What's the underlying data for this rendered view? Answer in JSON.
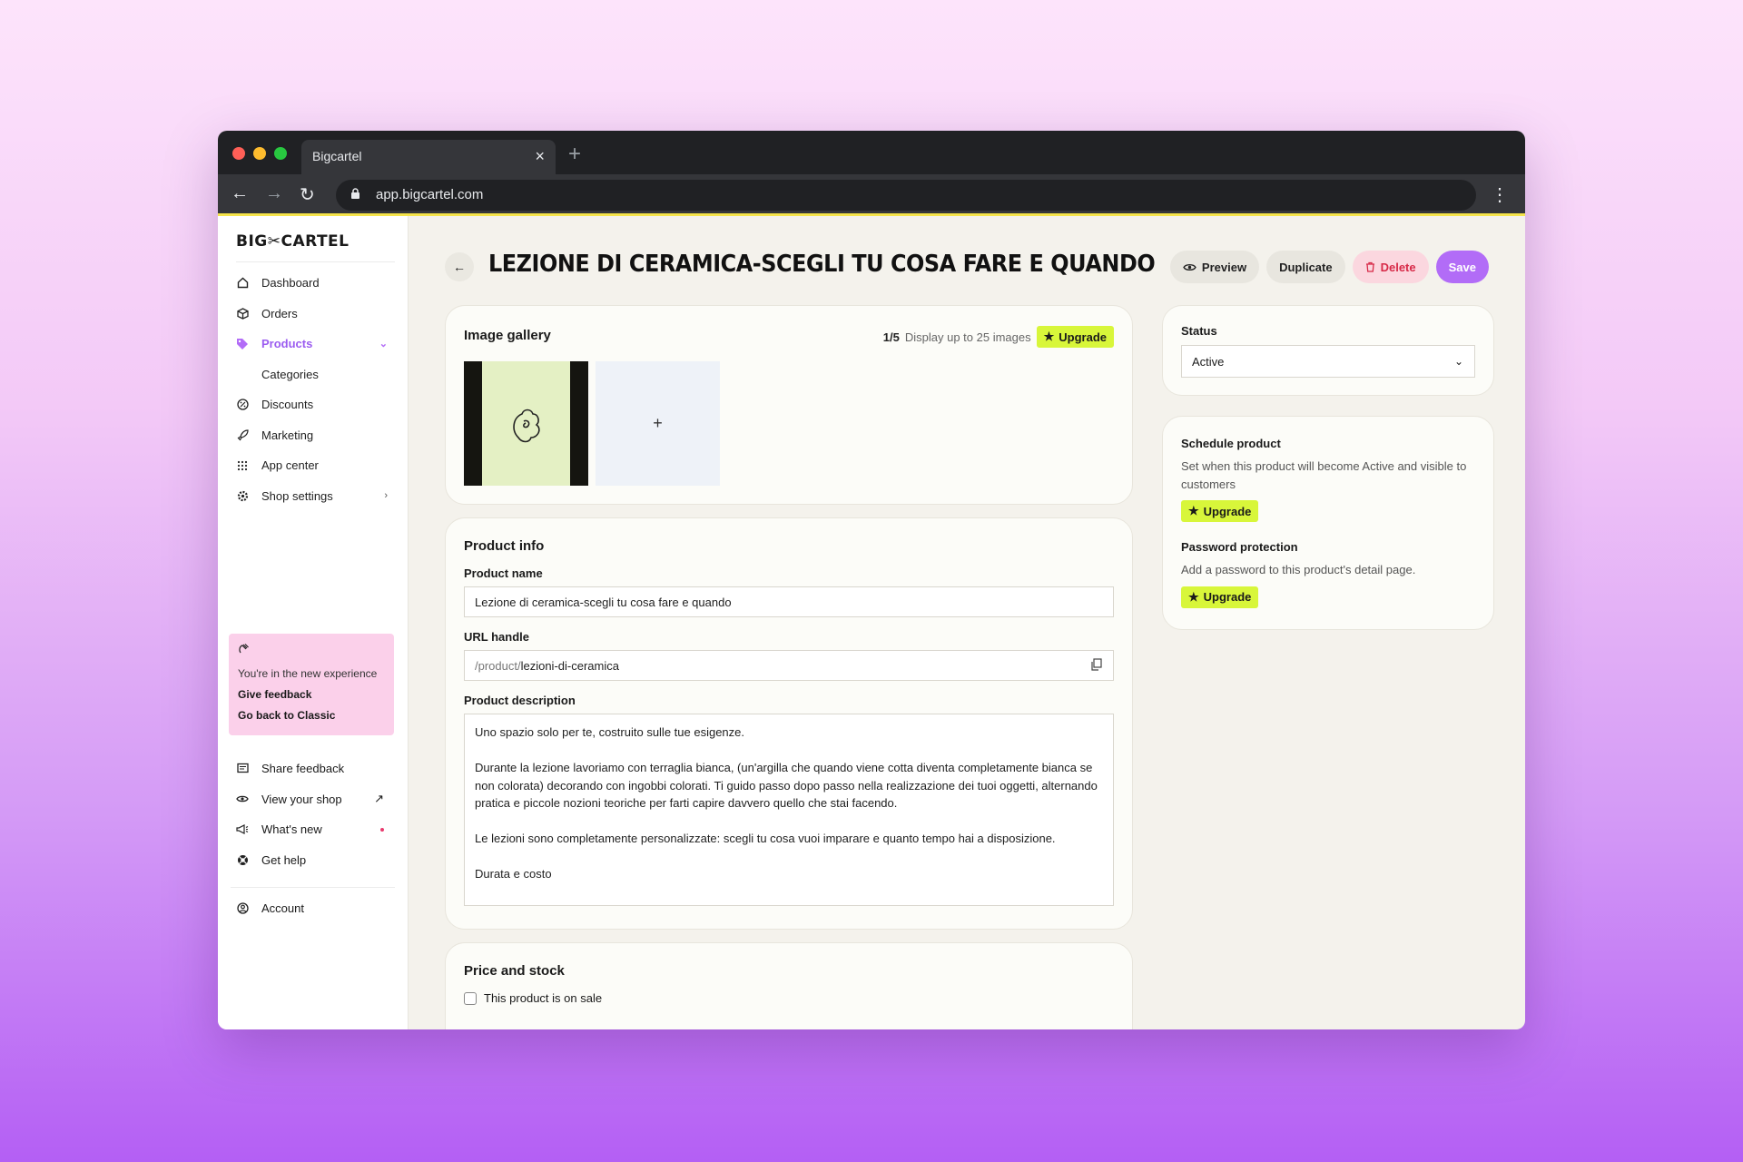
{
  "browser": {
    "tab_title": "Bigcartel",
    "close": "×",
    "new_tab": "+",
    "url": "app.bigcartel.com"
  },
  "sidebar": {
    "logo": "BIG✂CARTEL",
    "items": [
      {
        "label": "Dashboard",
        "icon": "home-icon"
      },
      {
        "label": "Orders",
        "icon": "box-icon"
      },
      {
        "label": "Products",
        "icon": "tag-icon",
        "active": true
      },
      {
        "label": "Categories"
      },
      {
        "label": "Discounts",
        "icon": "discount-icon"
      },
      {
        "label": "Marketing",
        "icon": "rocket-icon"
      },
      {
        "label": "App center",
        "icon": "grid-icon"
      },
      {
        "label": "Shop settings",
        "icon": "gear-icon"
      }
    ],
    "promo": {
      "text": "You're in the new experience",
      "feedback": "Give feedback",
      "classic": "Go back to Classic"
    },
    "bottom": [
      {
        "label": "Share feedback",
        "icon": "message-icon"
      },
      {
        "label": "View your shop",
        "icon": "eye-icon"
      },
      {
        "label": "What's new",
        "icon": "megaphone-icon"
      },
      {
        "label": "Get help",
        "icon": "lifebuoy-icon"
      },
      {
        "label": "Account",
        "icon": "user-icon"
      }
    ]
  },
  "header": {
    "title": "LEZIONE DI CERAMICA-SCEGLI TU COSA FARE E QUANDO",
    "preview": "Preview",
    "duplicate": "Duplicate",
    "delete": "Delete",
    "save": "Save"
  },
  "gallery": {
    "title": "Image gallery",
    "count": "1/5",
    "hint": "Display up to 25 images",
    "upgrade": "Upgrade",
    "add": "+"
  },
  "product_info": {
    "title": "Product info",
    "name_label": "Product name",
    "name_value": "Lezione di ceramica-scegli tu cosa fare e quando",
    "url_label": "URL handle",
    "url_prefix": "/product/",
    "url_value": "lezioni-di-ceramica",
    "desc_label": "Product description",
    "desc_paragraphs": [
      "Uno spazio solo per te, costruito sulle tue esigenze.",
      "Durante la lezione lavoriamo con terraglia bianca, (un'argilla che quando viene cotta diventa completamente bianca se non colorata) decorando con ingobbi colorati. Ti guido passo dopo passo nella realizzazione dei tuoi oggetti, alternando pratica e piccole nozioni teoriche per farti capire davvero quello che stai facendo.",
      "Le lezioni sono completamente personalizzate: scegli tu cosa vuoi imparare e quanto tempo hai a disposizione.",
      "Durata e costo"
    ]
  },
  "price": {
    "title": "Price and stock",
    "on_sale": "This product is on sale"
  },
  "status": {
    "label": "Status",
    "value": "Active"
  },
  "schedule": {
    "title": "Schedule product",
    "desc": "Set when this product will become Active and visible to customers",
    "upgrade": "Upgrade",
    "password_title": "Password protection",
    "password_desc": "Add a password to this product's detail page.",
    "password_upgrade": "Upgrade"
  },
  "colors": {
    "accent": "#b26cf7",
    "upgrade": "#d8f63a",
    "danger": "#d72a48",
    "promo": "#fbd0ea"
  }
}
